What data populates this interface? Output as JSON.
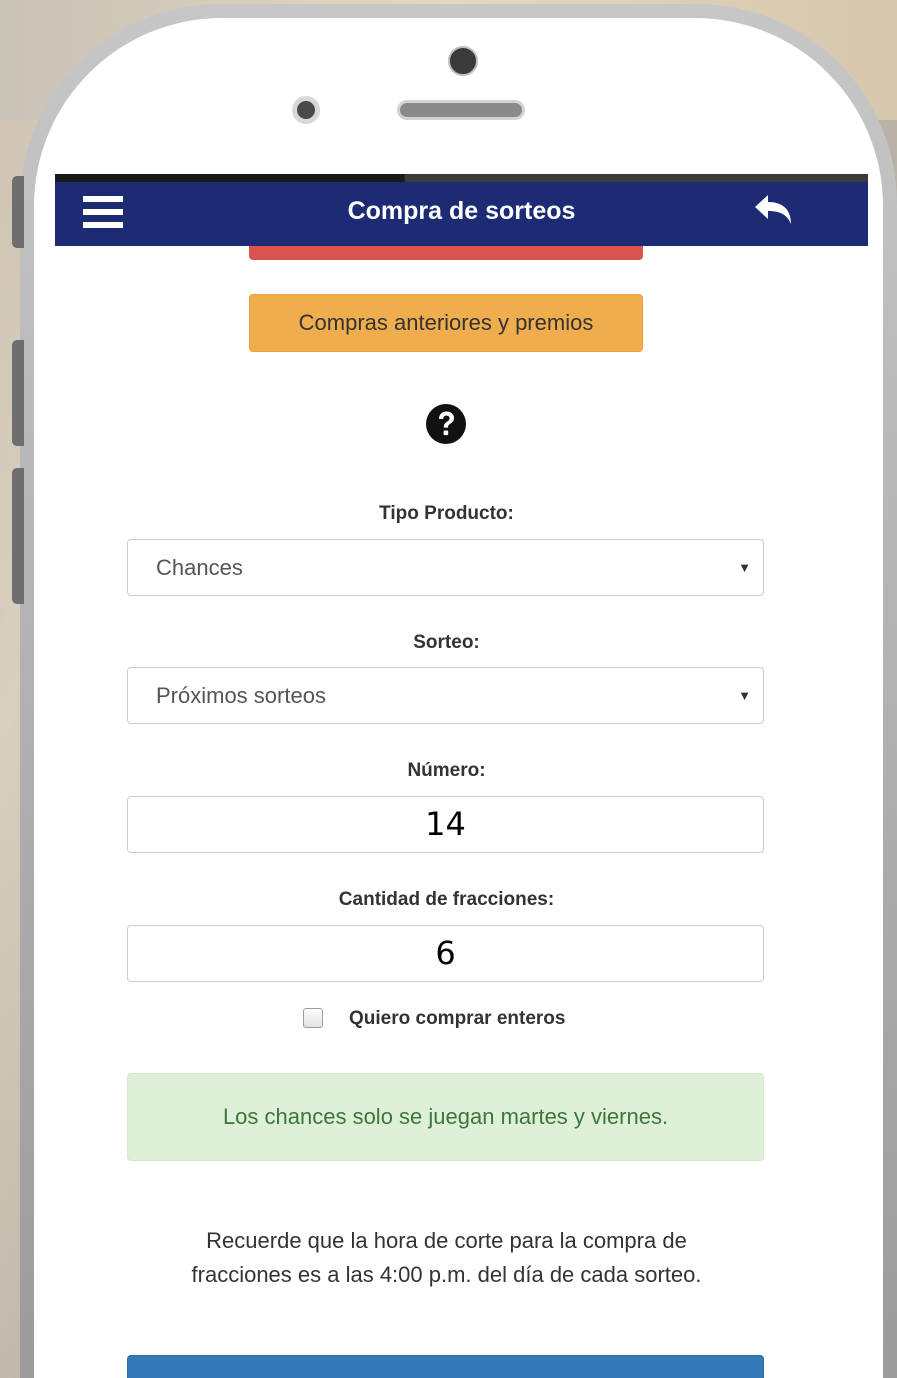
{
  "header": {
    "title": "Compra de sorteos",
    "menu_icon": "hamburger-menu-icon",
    "back_icon": "reply-arrow-icon"
  },
  "buttons": {
    "previous_purchases": "Compras anteriores y premios",
    "primary": ""
  },
  "help_icon": "question-circle-icon",
  "form": {
    "product_type": {
      "label": "Tipo Producto:",
      "value": "Chances"
    },
    "draw": {
      "label": "Sorteo:",
      "value": "Próximos sorteos"
    },
    "number": {
      "label": "Número:",
      "value": "14"
    },
    "fractions": {
      "label": "Cantidad de fracciones:",
      "value": "6"
    },
    "whole_checkbox": {
      "label": "Quiero comprar enteros",
      "checked": false
    }
  },
  "alert": {
    "text": "Los chances solo se juegan martes y viernes."
  },
  "note": {
    "line1": "Recuerde que la hora de corte para la compra de",
    "line2": "fracciones es a las 4:00 p.m. del día de cada sorteo."
  },
  "colors": {
    "header_bg": "#1c2b74",
    "warning": "#f0ad4e",
    "danger": "#d9534f",
    "success_bg": "#dff0d8",
    "success_text": "#3c763d",
    "primary": "#337ab7"
  }
}
